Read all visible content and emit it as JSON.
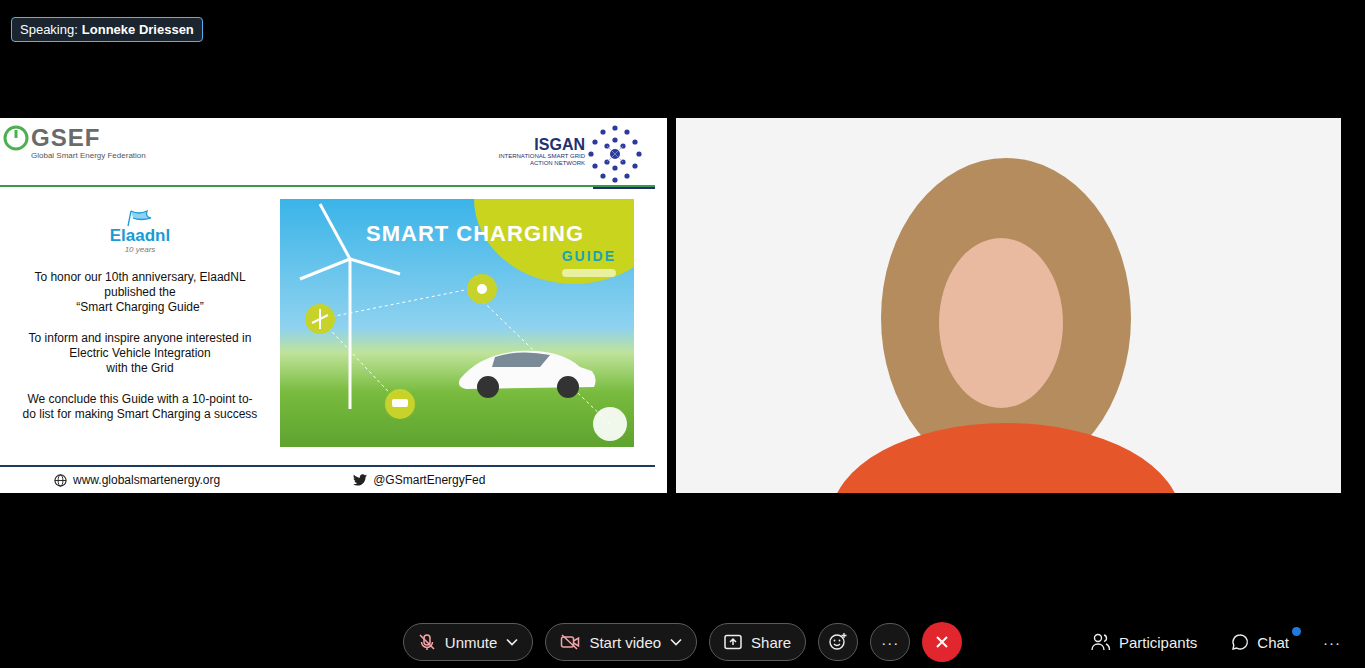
{
  "speaking": {
    "label": "Speaking:",
    "name": "Lonneke Driessen"
  },
  "slide": {
    "org_logo": {
      "name": "GSEF",
      "subtitle": "Global Smart Energy Federation"
    },
    "partner_logo": {
      "name": "ISGAN",
      "subtitle": "INTERNATIONAL SMART GRID ACTION NETWORK"
    },
    "brand_logo": {
      "name": "Elaadnl",
      "tagline": "10 years"
    },
    "paragraphs": [
      [
        "To honor our 10th anniversary, ElaadNL",
        "published the",
        "“Smart Charging Guide”"
      ],
      [
        "To inform and inspire anyone interested in",
        "Electric Vehicle Integration",
        "with the Grid"
      ],
      [
        "We conclude this Guide with a 10-point to-",
        "do list for making Smart Charging a success"
      ]
    ],
    "cover": {
      "title": "SMART CHARGING",
      "subtitle": "GUIDE"
    },
    "footer": {
      "website": "www.globalsmartenergy.org",
      "twitter": "@GSmartEnergyFed"
    }
  },
  "toolbar": {
    "audio": {
      "label": "Unmute",
      "muted": true
    },
    "camera": {
      "label": "Start video",
      "on": false
    },
    "share": {
      "label": "Share"
    },
    "more": {
      "label": "···"
    },
    "participants": {
      "label": "Participants"
    },
    "chat": {
      "label": "Chat",
      "unread": true
    },
    "more_right": {
      "label": "···"
    }
  }
}
